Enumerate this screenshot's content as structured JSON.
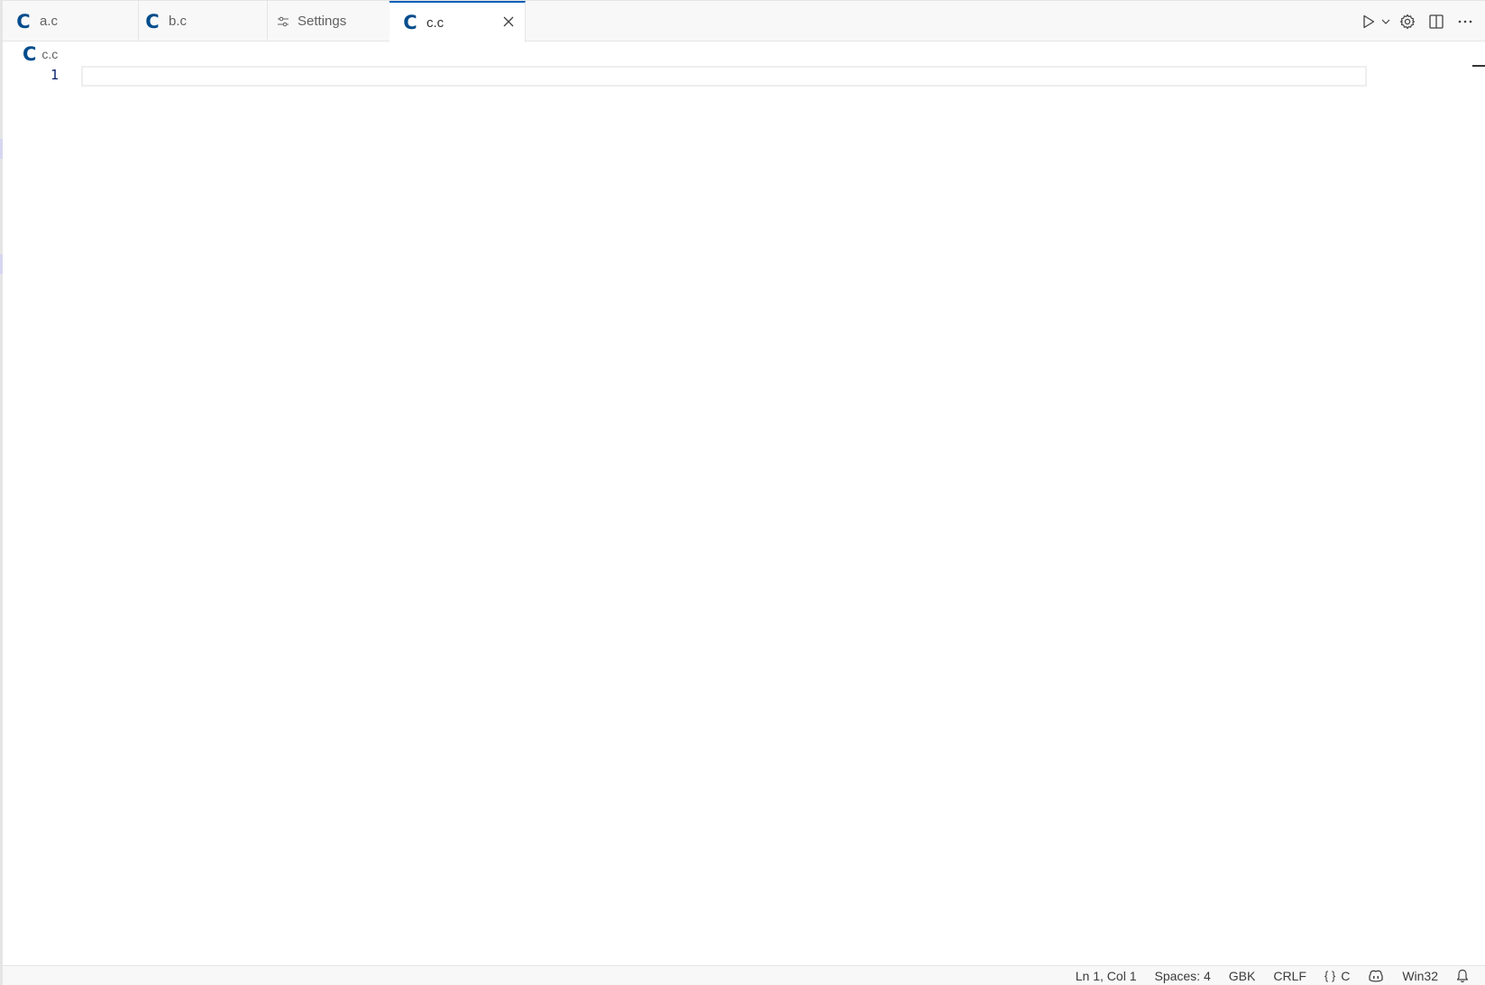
{
  "tabs": [
    {
      "label": "a.c",
      "icon": "c-language-icon",
      "active": false
    },
    {
      "label": "b.c",
      "icon": "c-language-icon",
      "active": false
    },
    {
      "label": "Settings",
      "icon": "settings-sliders-icon",
      "active": false
    },
    {
      "label": "c.c",
      "icon": "c-language-icon",
      "active": true
    }
  ],
  "c_glyph": "C",
  "breadcrumb": {
    "file": "c.c"
  },
  "editor": {
    "line_numbers": [
      "1"
    ],
    "content": ""
  },
  "actions": [
    "run-icon",
    "chevron-down-icon",
    "gear-icon",
    "split-editor-icon",
    "more-icon"
  ],
  "statusbar": {
    "position": "Ln 1, Col 1",
    "indentation": "Spaces: 4",
    "encoding": "GBK",
    "eol": "CRLF",
    "language_braces": "{ }",
    "language": "C",
    "configuration": "Win32"
  },
  "colors": {
    "accent": "#005fb8",
    "c_icon": "#004c8c",
    "line_number": "#0b216f"
  }
}
